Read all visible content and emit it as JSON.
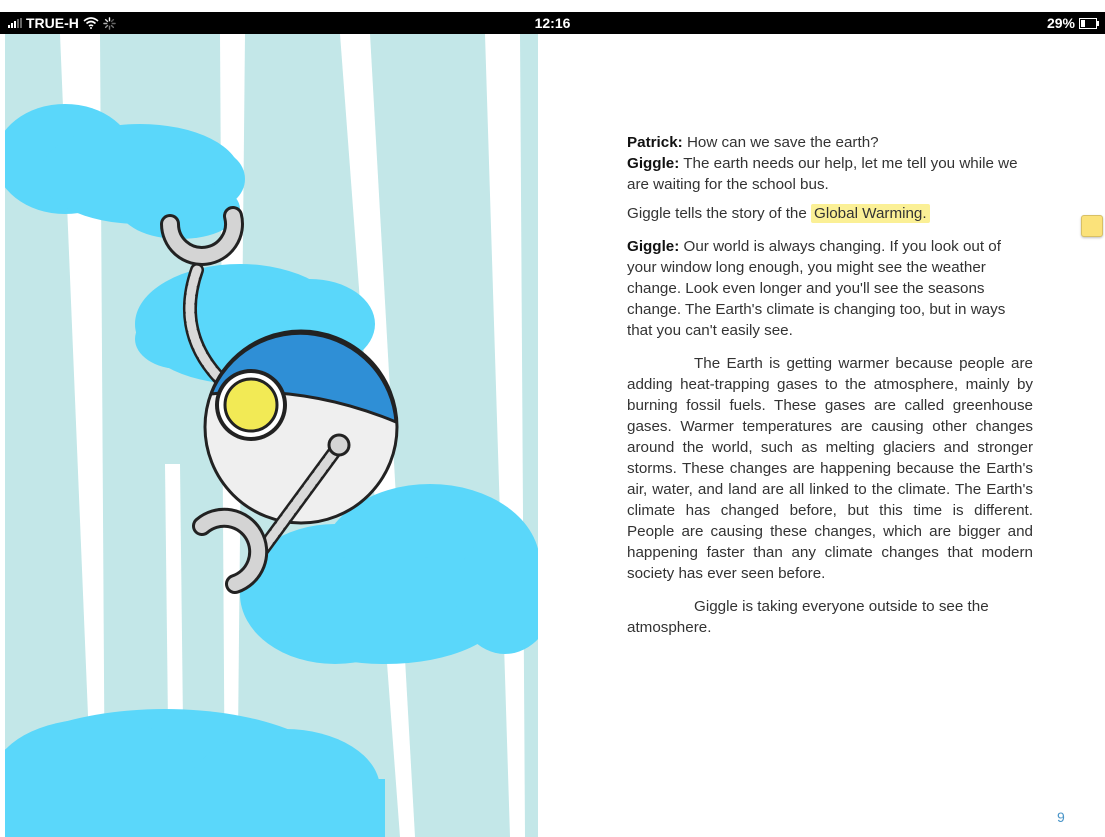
{
  "status_bar": {
    "carrier": "TRUE-H",
    "time": "12:16",
    "battery_text": "29%",
    "battery_level": 0.29
  },
  "book": {
    "dialogue": [
      {
        "speaker": "Patrick:",
        "line": "How can we save the earth?"
      },
      {
        "speaker": "Giggle:",
        "line": "The earth needs our help, let me tell you while we are waiting for the school bus."
      }
    ],
    "story_intro_prefix": "Giggle tells the story of the",
    "story_intro_highlight": "Global Warming.",
    "giggle_speaker": "Giggle:",
    "giggle_text": "Our world is always changing. If you look out of your window long enough, you might see the weather change. Look even longer and you'll see the seasons change. The Earth's climate is changing too, but in ways that you can't easily see.",
    "paragraph_main": "The Earth is getting warmer because people are adding heat-trapping gases to the atmosphere, mainly by burning fossil fuels. These gases are called greenhouse gases. Warmer temperatures are causing other changes around the world, such as melting glaciers and stronger storms. These changes are happening because the Earth's air, water, and land are all linked to the climate. The Earth's climate has changed before, but this time is different. People are causing these changes, which are bigger and happening faster than any climate changes that modern society has ever seen before.",
    "paragraph_final": "Giggle is taking everyone outside to see the atmosphere.",
    "page_number": "9",
    "highlight_color": "#fbf096",
    "page_number_color": "#4a95c8"
  },
  "illustration": {
    "sky_color": "#c3e7e8",
    "cloud_color": "#5ad7fa",
    "robot_cap_color": "#2f8fd6",
    "robot_eye_color": "#f2ea55",
    "icons": [
      "robot-character",
      "cloud",
      "note-icon",
      "wifi-icon",
      "loading-spinner-icon",
      "battery-icon",
      "signal-icon"
    ]
  }
}
